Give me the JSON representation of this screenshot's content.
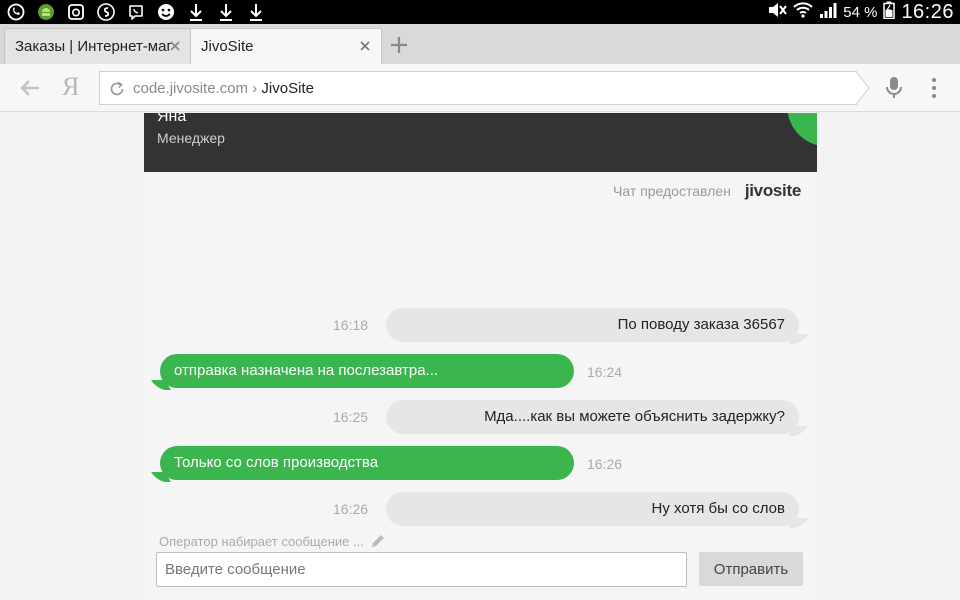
{
  "status_bar": {
    "left_icons": [
      "whatsapp-icon",
      "android-icon",
      "instagram-icon",
      "shazam-icon",
      "viber-icon",
      "smiley-icon",
      "download-icon",
      "download-icon",
      "download-icon"
    ],
    "battery": "54 %",
    "clock": "16:26"
  },
  "tabs": [
    {
      "title": "Заказы | Интернет-маг",
      "active": false
    },
    {
      "title": "JivoSite",
      "active": true
    }
  ],
  "address_bar": {
    "domain": "code.jivosite.com",
    "separator": " › ",
    "page": "JivoSite"
  },
  "browser": {
    "ya_logo": "Я"
  },
  "chat": {
    "operator_name": "Яна",
    "operator_role": "Менеджер",
    "powered_by": "Чат предоставлен",
    "logo_text": "jivosite",
    "messages": [
      {
        "from": "visitor",
        "time": "16:18",
        "text": "По поводу заказа 36567"
      },
      {
        "from": "operator",
        "time": "16:24",
        "text": "отправка назначена на послезавтра..."
      },
      {
        "from": "visitor",
        "time": "16:25",
        "text": "Мда....как вы можете объяснить задержку?"
      },
      {
        "from": "operator",
        "time": "16:26",
        "text": "Только со слов производства"
      },
      {
        "from": "visitor",
        "time": "16:26",
        "text": "Ну хотя бы со слов"
      }
    ],
    "typing_indicator": "Оператор набирает сообщение ...",
    "input_placeholder": "Введите сообщение",
    "send_label": "Отправить",
    "accent_color": "#3bb64f",
    "header_color": "#333333"
  }
}
